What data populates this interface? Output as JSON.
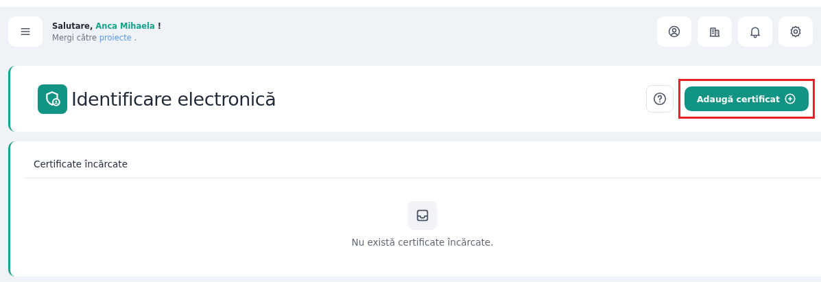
{
  "header": {
    "greeting": "Salutare,",
    "user_name": "Anca Mihaela",
    "greeting_end": "!",
    "nav_text": "Mergi către",
    "nav_link": "proiecte",
    "nav_end": ".",
    "actions": [
      {
        "kind": "user"
      },
      {
        "kind": "building"
      },
      {
        "kind": "bell"
      },
      {
        "kind": "gear"
      }
    ]
  },
  "title_card": {
    "title": "Identificare electronică",
    "add_button": {
      "label": "Adaugă certificat",
      "highlighted": true
    }
  },
  "certificates": {
    "heading": "Certificate încărcate",
    "empty_message": "Nu există certificate încărcate."
  }
}
